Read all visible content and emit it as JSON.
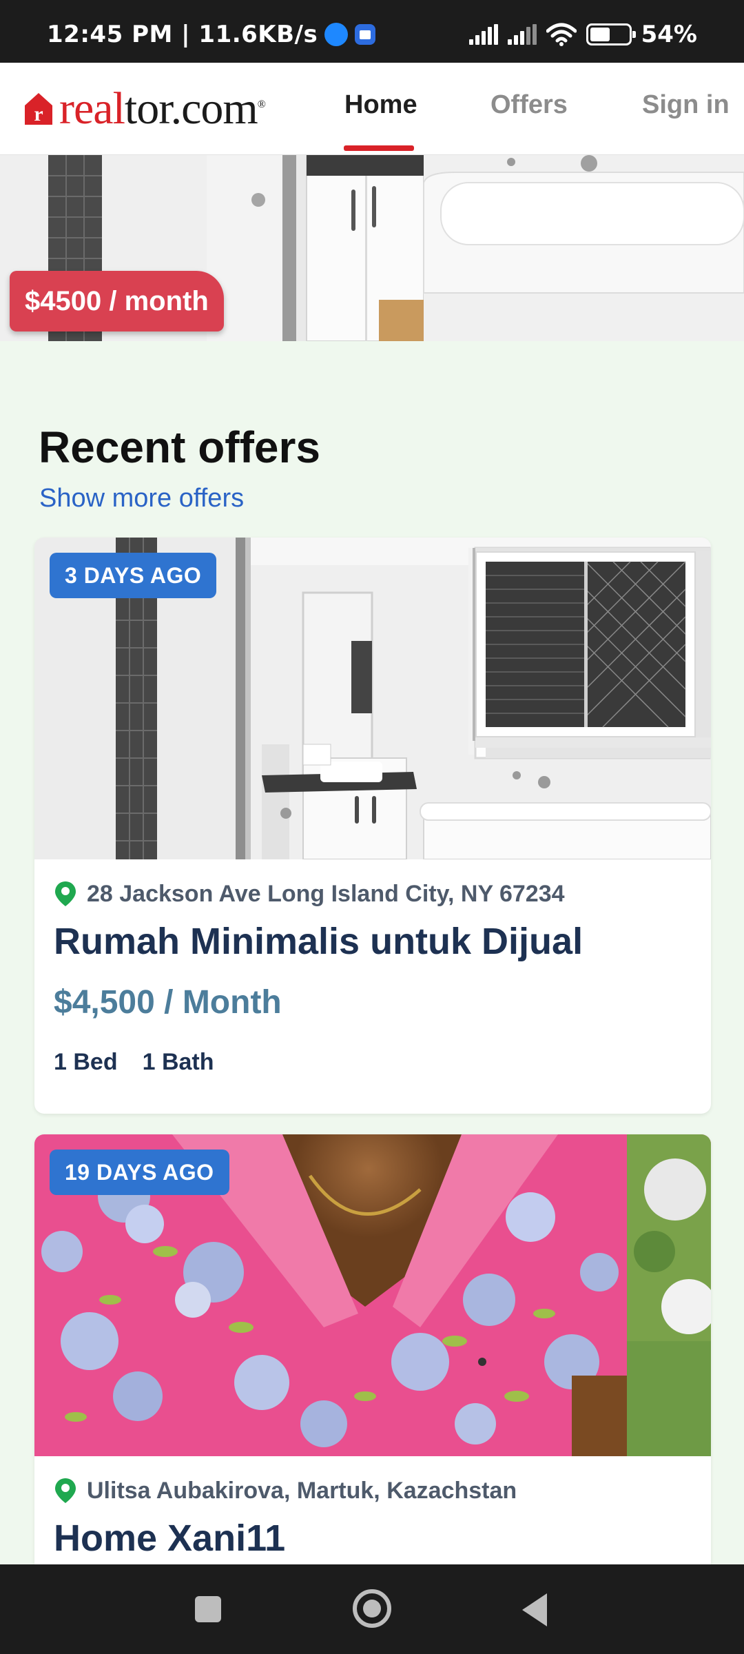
{
  "status_bar": {
    "time": "12:45 PM | 11.6KB/s",
    "battery": "54%",
    "icons": [
      "messenger-icon",
      "calendar-icon",
      "signal-icon",
      "wifi-icon",
      "battery-icon"
    ]
  },
  "header": {
    "logo_text_red": "real",
    "logo_text_dark": "tor.com",
    "logo_suffix": "®",
    "nav": [
      {
        "label": "Home",
        "active": true
      },
      {
        "label": "Offers",
        "active": false
      },
      {
        "label": "Sign in",
        "active": false
      }
    ]
  },
  "banner": {
    "price_tag": "$4500 / month"
  },
  "recent_offers": {
    "title": "Recent offers",
    "show_more": "Show more offers",
    "cards": [
      {
        "badge": "3 DAYS AGO",
        "address": "28 Jackson Ave Long Island City, NY 67234",
        "title": "Rumah Minimalis untuk Dijual",
        "price": "$4,500 / Month",
        "beds": "1 Bed",
        "baths": "1 Bath",
        "image": "bathroom-photo"
      },
      {
        "badge": "19 DAYS AGO",
        "address": "Ulitsa Aubakirova, Martuk, Kazachstan",
        "title": "Home Xani11",
        "image": "floral-shirt-photo"
      }
    ]
  },
  "colors": {
    "brand_red": "#d92228",
    "badge_blue": "#2f74d0",
    "link_blue": "#2a63c6",
    "title_navy": "#1d3152",
    "price_teal": "#4c7d9b",
    "page_bg": "#eff8ee",
    "pin_green": "#1fa84f"
  }
}
